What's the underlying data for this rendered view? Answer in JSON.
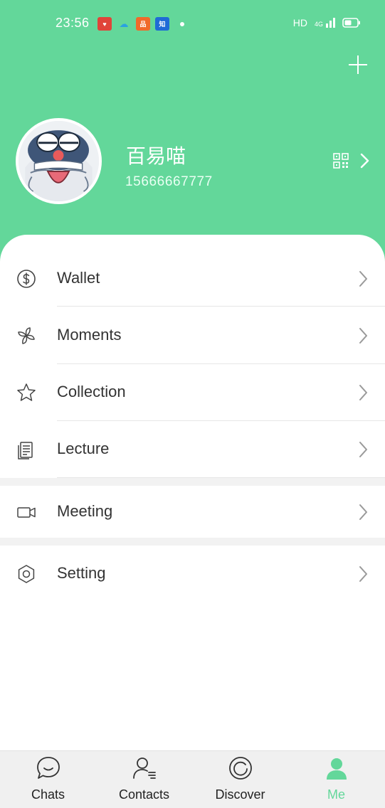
{
  "status_bar": {
    "time": "23:56",
    "network": "HD",
    "signal_label": "4G",
    "apps": [
      {
        "name": "app-red",
        "color": "#e0443a",
        "glyph": "♥"
      },
      {
        "name": "app-cloud",
        "color": "#2aa2e0",
        "glyph": "☁"
      },
      {
        "name": "app-orange",
        "color": "#f06a2a",
        "glyph": "品"
      },
      {
        "name": "app-zhihu",
        "color": "#1f6bd6",
        "glyph": "知"
      }
    ]
  },
  "header": {
    "add_icon": "plus-icon",
    "background_color": "#63d79a"
  },
  "profile": {
    "name": "百易喵",
    "id": "15666667777",
    "qr_icon": "qr-code-icon",
    "arrow_icon": "chevron-right-icon"
  },
  "menu": [
    {
      "key": "wallet",
      "label": "Wallet",
      "icon": "dollar-circle-icon"
    },
    {
      "key": "moments",
      "label": "Moments",
      "icon": "pinwheel-icon"
    },
    {
      "key": "collection",
      "label": "Collection",
      "icon": "star-icon"
    },
    {
      "key": "lecture",
      "label": "Lecture",
      "icon": "document-icon"
    },
    {
      "key": "meeting",
      "label": "Meeting",
      "icon": "video-camera-icon"
    },
    {
      "key": "setting",
      "label": "Setting",
      "icon": "hexagon-gear-icon"
    }
  ],
  "tabs": [
    {
      "key": "chats",
      "label": "Chats",
      "icon": "chat-bubble-icon",
      "active": false
    },
    {
      "key": "contacts",
      "label": "Contacts",
      "icon": "contacts-icon",
      "active": false
    },
    {
      "key": "discover",
      "label": "Discover",
      "icon": "compass-icon",
      "active": false
    },
    {
      "key": "me",
      "label": "Me",
      "icon": "person-icon",
      "active": true
    }
  ],
  "colors": {
    "accent": "#63d79a",
    "text": "#333333",
    "icon": "#444444",
    "chevron": "#9a9a9a"
  }
}
